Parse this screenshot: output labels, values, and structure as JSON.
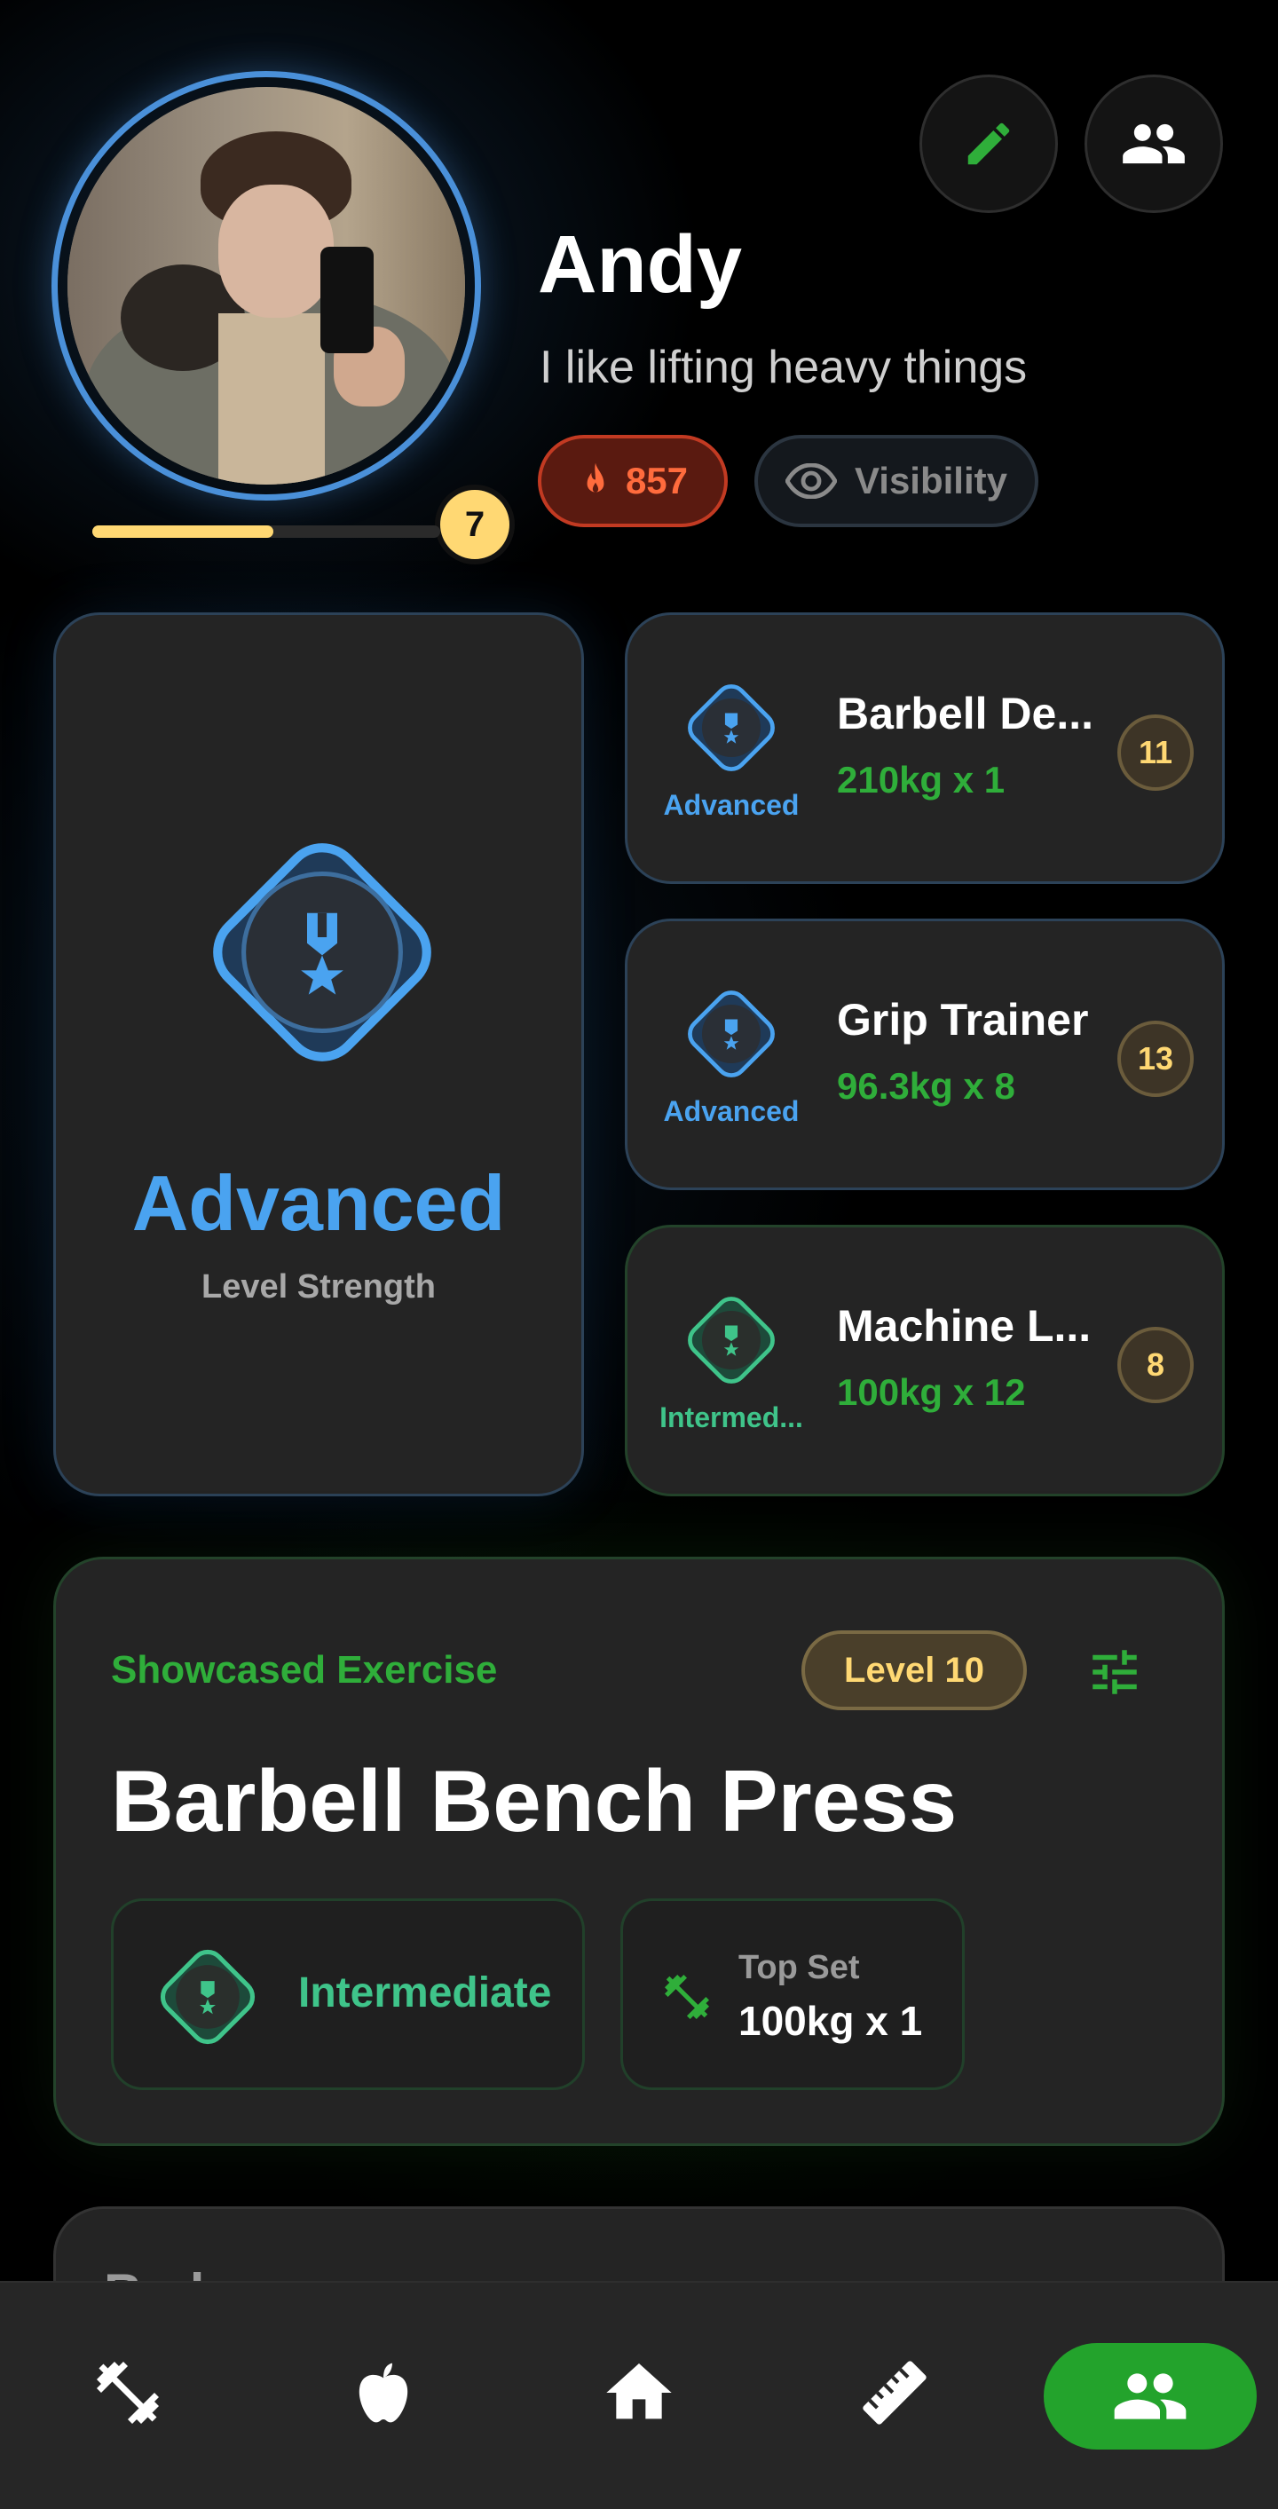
{
  "profile": {
    "name": "Andy",
    "bio": "I like lifting heavy things",
    "level": "7",
    "xp_progress": 0.52,
    "streak": "857",
    "visibility_label": "Visibility"
  },
  "strength": {
    "rank": "Advanced",
    "subtitle": "Level Strength",
    "color": "#4aa3f0"
  },
  "top_exercises": [
    {
      "rank": "Advanced",
      "name": "Barbell De...",
      "value": "210kg x 1",
      "level": "11",
      "rank_color": "#4aa3f0"
    },
    {
      "rank": "Advanced",
      "name": "Grip Trainer",
      "value": "96.3kg x 8",
      "level": "13",
      "rank_color": "#4aa3f0"
    },
    {
      "rank": "Intermed...",
      "name": "Machine L...",
      "value": "100kg x 12",
      "level": "8",
      "rank_color": "#3fc48a"
    }
  ],
  "showcase": {
    "label": "Showcased Exercise",
    "level": "Level 10",
    "title": "Barbell Bench Press",
    "rank": "Intermediate",
    "top_set_label": "Top Set",
    "top_set_value": "100kg x 1"
  },
  "next_section": {
    "title": "Bad..."
  },
  "nav": {
    "items": [
      "dumbbell-icon",
      "apple-icon",
      "home-icon",
      "ruler-icon",
      "people-icon"
    ],
    "active": "people-icon"
  },
  "colors": {
    "accent_green": "#23a32c",
    "advanced_blue": "#4aa3f0",
    "intermediate_teal": "#3fc48a",
    "gold": "#ffd873",
    "streak_orange": "#ff6b3d"
  }
}
